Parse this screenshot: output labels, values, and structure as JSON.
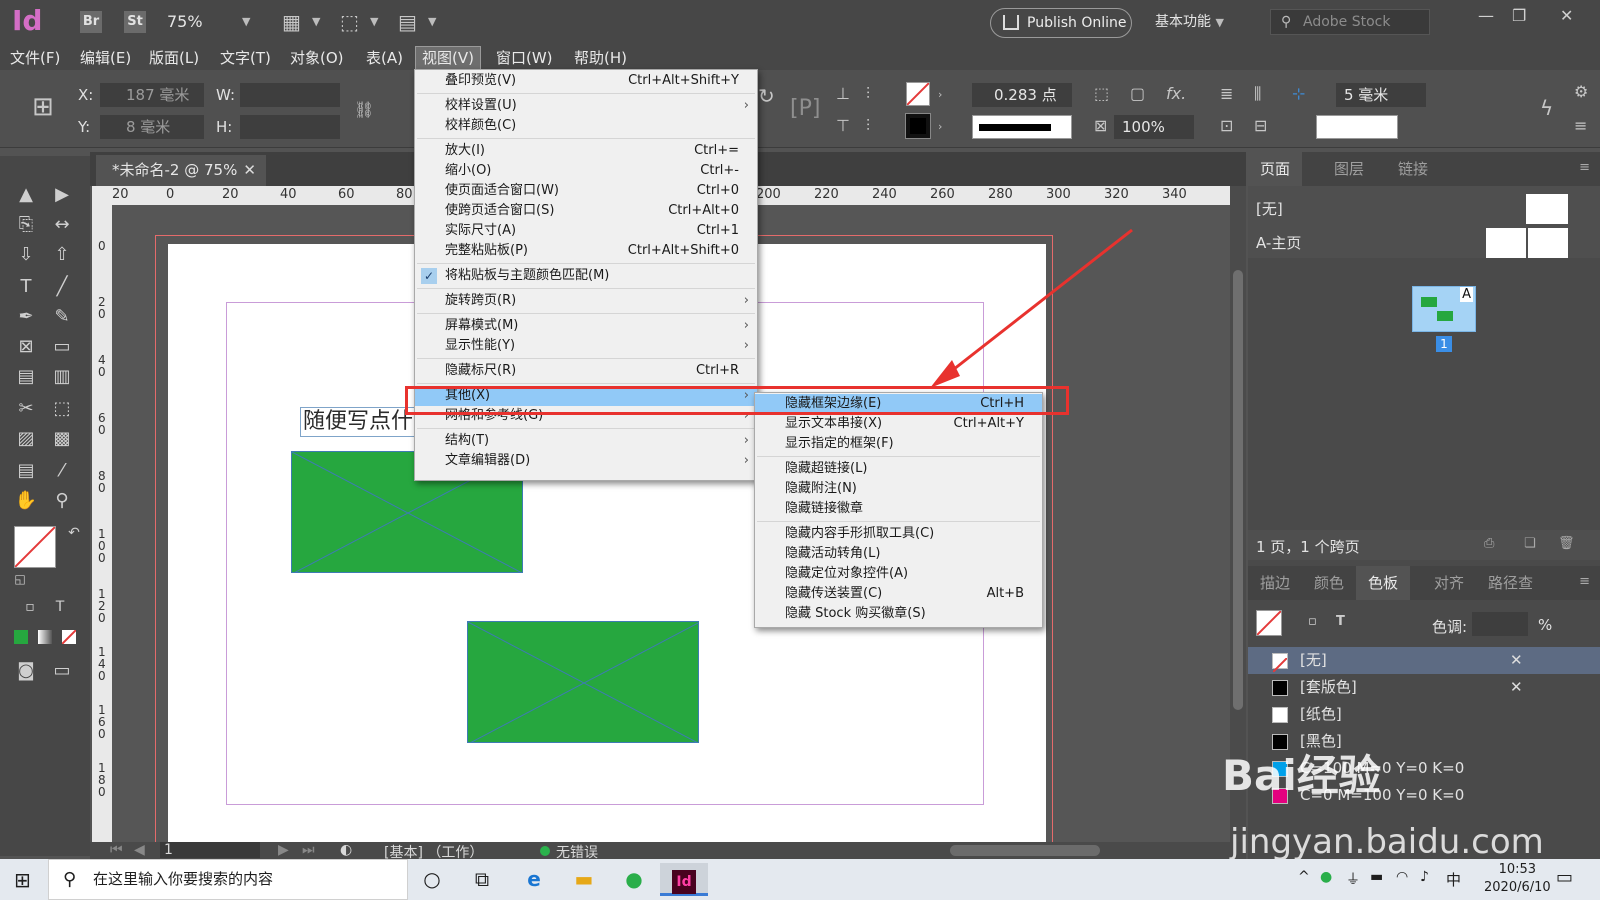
{
  "app": {
    "logo": "Id",
    "bridge": "Br",
    "stock": "St",
    "zoom": "75%",
    "publish": "Publish Online",
    "workspace": "基本功能",
    "stock_search_placeholder": "Adobe Stock"
  },
  "menubar": [
    "文件(F)",
    "编辑(E)",
    "版面(L)",
    "文字(T)",
    "对象(O)",
    "表(A)",
    "视图(V)",
    "窗口(W)",
    "帮助(H)"
  ],
  "control": {
    "x_label": "X:",
    "x_value": "187 毫米",
    "y_label": "Y:",
    "y_value": "8 毫米",
    "w_label": "W:",
    "h_label": "H:",
    "stroke_weight": "0.283 点",
    "opacity": "100%",
    "spacing": "5 毫米"
  },
  "document": {
    "tab": "*未命名-2 @ 75%",
    "text": "随便写点什",
    "ruler_h": [
      "20",
      "0",
      "20",
      "40",
      "60",
      "80",
      "200",
      "220",
      "240",
      "260",
      "280",
      "300",
      "320",
      "340"
    ],
    "ruler_v": [
      "0",
      "2\n0",
      "4\n0",
      "6\n0",
      "8\n0",
      "1\n0\n0",
      "1\n2\n0",
      "1\n4\n0",
      "1\n6\n0",
      "1\n8\n0"
    ]
  },
  "view_menu": [
    {
      "label": "叠印预览(V)",
      "shortcut": "Ctrl+Alt+Shift+Y"
    },
    {
      "sep": true
    },
    {
      "label": "校样设置(U)",
      "arrow": true
    },
    {
      "label": "校样颜色(C)"
    },
    {
      "sep": true
    },
    {
      "label": "放大(I)",
      "shortcut": "Ctrl+="
    },
    {
      "label": "缩小(O)",
      "shortcut": "Ctrl+-"
    },
    {
      "label": "使页面适合窗口(W)",
      "shortcut": "Ctrl+0"
    },
    {
      "label": "使跨页适合窗口(S)",
      "shortcut": "Ctrl+Alt+0"
    },
    {
      "label": "实际尺寸(A)",
      "shortcut": "Ctrl+1"
    },
    {
      "label": "完整粘贴板(P)",
      "shortcut": "Ctrl+Alt+Shift+0"
    },
    {
      "sep": true
    },
    {
      "label": "将粘贴板与主题颜色匹配(M)",
      "checked": true
    },
    {
      "sep": true
    },
    {
      "label": "旋转跨页(R)",
      "arrow": true
    },
    {
      "sep": true
    },
    {
      "label": "屏幕模式(M)",
      "arrow": true
    },
    {
      "label": "显示性能(Y)",
      "arrow": true
    },
    {
      "sep": true
    },
    {
      "label": "隐藏标尺(R)",
      "shortcut": "Ctrl+R"
    },
    {
      "sep": true
    },
    {
      "label": "其他(X)",
      "arrow": true,
      "highlighted": true
    },
    {
      "label": "网格和参考线(G)",
      "arrow": true
    },
    {
      "sep": true
    },
    {
      "label": "结构(T)",
      "arrow": true
    },
    {
      "label": "文章编辑器(D)",
      "arrow": true
    }
  ],
  "other_menu": [
    {
      "label": "隐藏框架边缘(E)",
      "shortcut": "Ctrl+H",
      "highlighted": true
    },
    {
      "label": "显示文本串接(X)",
      "shortcut": "Ctrl+Alt+Y"
    },
    {
      "label": "显示指定的框架(F)"
    },
    {
      "sep": true
    },
    {
      "label": "隐藏超链接(L)"
    },
    {
      "label": "隐藏附注(N)"
    },
    {
      "label": "隐藏链接徽章"
    },
    {
      "sep": true
    },
    {
      "label": "隐藏内容手形抓取工具(C)"
    },
    {
      "label": "隐藏活动转角(L)"
    },
    {
      "label": "隐藏定位对象控件(A)"
    },
    {
      "label": "隐藏传送装置(C)",
      "shortcut": "Alt+B"
    },
    {
      "label": "隐藏 Stock 购买徽章(S)"
    }
  ],
  "pages_panel": {
    "tabs": [
      "页面",
      "图层",
      "链接"
    ],
    "none": "[无]",
    "master": "A-主页",
    "page_num": "1",
    "master_letter": "A",
    "summary": "1 页，1 个跨页"
  },
  "swatch_panel": {
    "tabs": [
      "描边",
      "颜色",
      "色板",
      "对齐",
      "路径查"
    ],
    "tint_label": "色调:",
    "percent": "%",
    "rows": [
      {
        "name": "[无]",
        "color": "#ffffff",
        "selected": true
      },
      {
        "name": "[套版色]",
        "color": "#000000"
      },
      {
        "name": "[纸色]",
        "color": "#ffffff"
      },
      {
        "name": "[黑色]",
        "color": "#000000"
      },
      {
        "name": "C=100 M=0 Y=0 K=0",
        "color": "#00a0e9"
      },
      {
        "name": "C=0 M=100 Y=0 K=0",
        "color": "#e4007f"
      }
    ]
  },
  "statusbar": {
    "page": "1",
    "profile": "[基本] （工作）",
    "preflight": "无错误"
  },
  "taskbar": {
    "search": "在这里输入你要搜索的内容",
    "time": "10:53",
    "date": "2020/6/10",
    "ime": "中"
  },
  "watermark": {
    "line1": "Bai经验",
    "line2": "jingyan.baidu.com"
  },
  "colors": {
    "frame_green": "#26a73f",
    "highlight_red": "#e8322e",
    "menu_highlight": "#91c9f7",
    "indesign_pink": "#d46ec6"
  }
}
